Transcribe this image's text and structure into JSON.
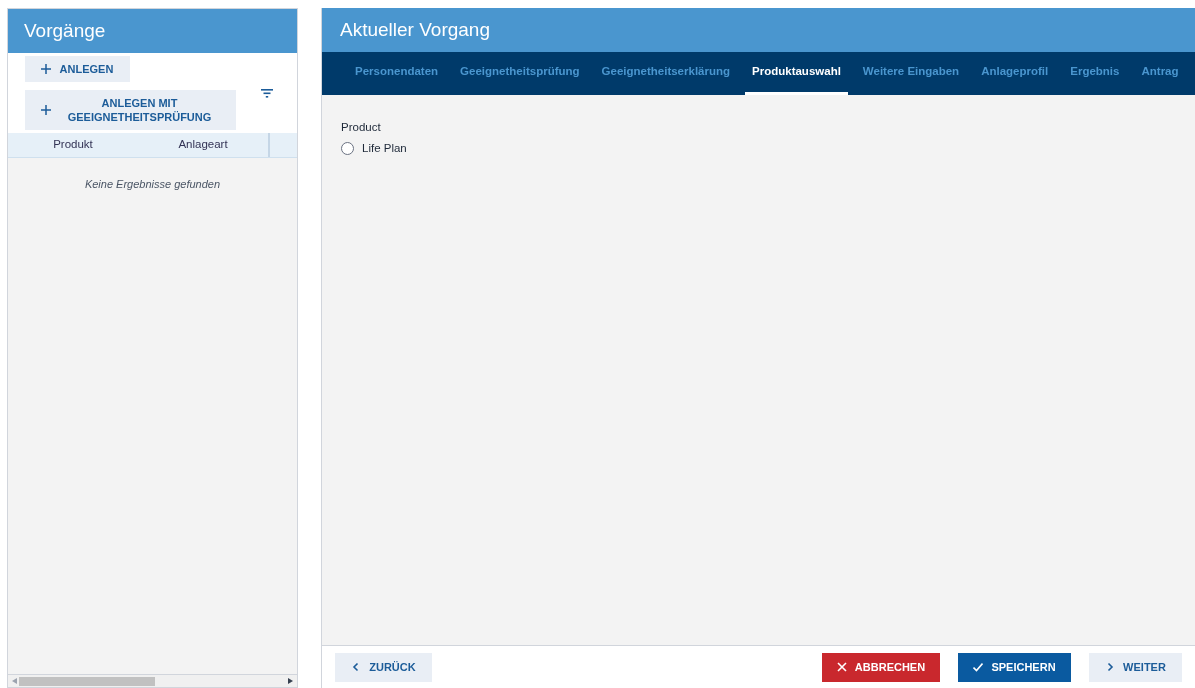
{
  "sidebar": {
    "title": "Vorgänge",
    "buttons": [
      "ANLEGEN",
      "ANLEGEN MIT GEEIGNETHEITSPRÜFUNG"
    ],
    "table": {
      "columns": [
        "Produkt",
        "Anlageart"
      ],
      "empty_message": "Keine Ergebnisse gefunden"
    }
  },
  "main": {
    "title": "Aktueller Vorgang",
    "tabs": [
      {
        "label": "Personendaten",
        "selected": false
      },
      {
        "label": "Geeignetheitsprüfung",
        "selected": false
      },
      {
        "label": "Geeignetheitserklärung",
        "selected": false
      },
      {
        "label": "Produktauswahl",
        "selected": true
      },
      {
        "label": "Weitere Eingaben",
        "selected": false
      },
      {
        "label": "Anlageprofil",
        "selected": false
      },
      {
        "label": "Ergebnis",
        "selected": false
      },
      {
        "label": "Antrag",
        "selected": false
      }
    ],
    "field": {
      "label": "Product",
      "options": [
        {
          "label": "Life Plan",
          "selected": false
        }
      ]
    },
    "footer_buttons": [
      {
        "label": "ZURÜCK",
        "kind": "back"
      },
      {
        "label": "ABBRECHEN",
        "kind": "cancel"
      },
      {
        "label": "SPEICHERN",
        "kind": "save"
      },
      {
        "label": "WEITER",
        "kind": "next"
      }
    ]
  }
}
